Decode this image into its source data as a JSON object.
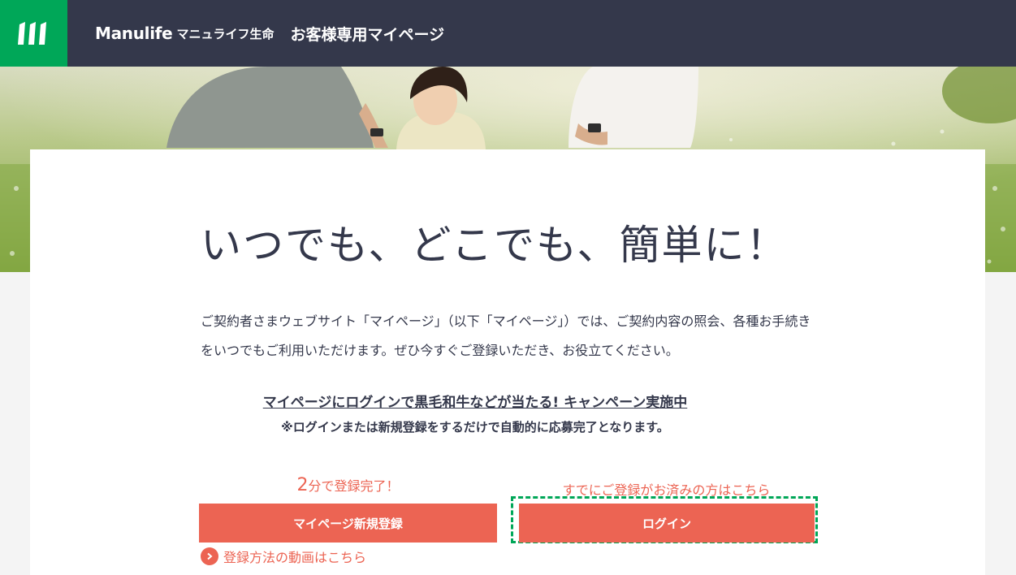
{
  "header": {
    "brand_en": "Manulife",
    "brand_ja": "マニュライフ生命",
    "site_title": "お客様専用マイページ"
  },
  "main": {
    "headline": "いつでも、どこでも、簡単に！",
    "intro": "ご契約者さまウェブサイト「マイページ」（以下「マイページ」）では、ご契約内容の照会、各種お手続きをいつでもご利用いただけます。ぜひ今すぐご登録いただき、お役立てください。",
    "campaign_link": "マイページにログインで黒毛和牛などが当たる! キャンペーン実施中",
    "campaign_note": "※ログインまたは新規登録をするだけで自動的に応募完了となります。"
  },
  "register": {
    "caption_num": "2",
    "caption_rest": "分で登録完了！",
    "button_label": "マイページ新規登録",
    "video_link": "登録方法の動画はこちら"
  },
  "login": {
    "caption": "すでにご登録がお済みの方はこちら",
    "button_label": "ログイン"
  },
  "colors": {
    "brand_green": "#00a758",
    "navy": "#34384b",
    "coral": "#ec6453"
  }
}
